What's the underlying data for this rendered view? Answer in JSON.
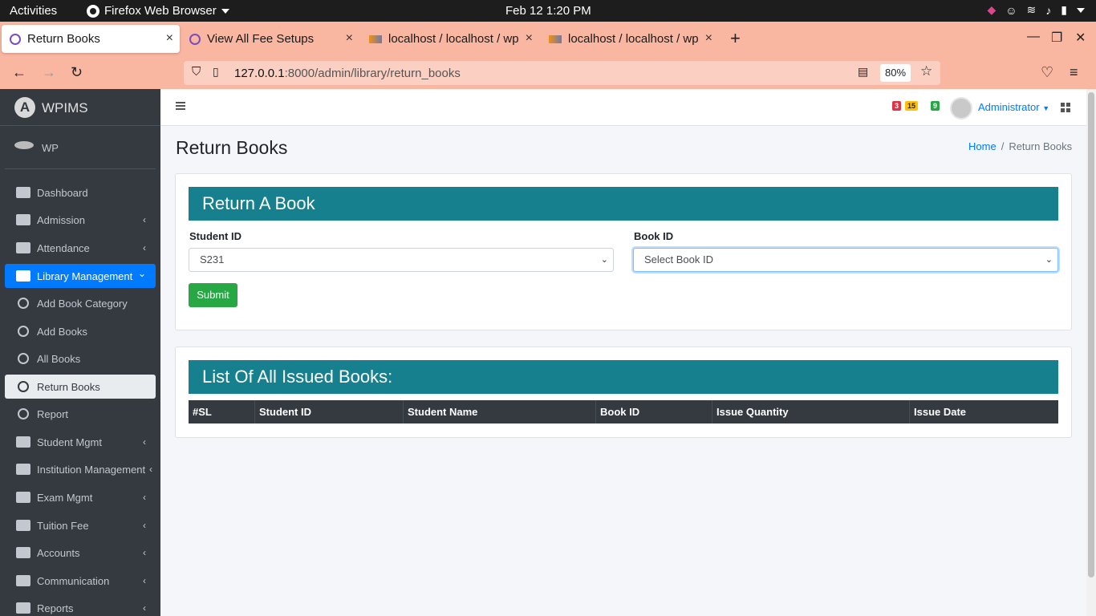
{
  "os": {
    "activities": "Activities",
    "app_name": "Firefox Web Browser",
    "clock": "Feb 12  1:20 PM"
  },
  "browser": {
    "tabs": [
      {
        "title": "Return Books",
        "active": true
      },
      {
        "title": "View All Fee Setups",
        "active": false
      },
      {
        "title": "localhost / localhost / wp",
        "active": false
      },
      {
        "title": "localhost / localhost / wp",
        "active": false
      }
    ],
    "url_host": "127.0.0.1",
    "url_rest": ":8000/admin/library/return_books",
    "zoom": "80%"
  },
  "sidebar": {
    "brand": "WPIMS",
    "brand_logo": "A",
    "user": "WP",
    "items": [
      {
        "label": "Dashboard",
        "icon": "dashboard-icon"
      },
      {
        "label": "Admission",
        "icon": "user-plus-icon",
        "arrow": "‹"
      },
      {
        "label": "Attendance",
        "icon": "tree-icon",
        "arrow": "‹"
      },
      {
        "label": "Library Management",
        "icon": "book-icon",
        "arrow": "⌄"
      },
      {
        "label": "Add Book Category",
        "icon": "circle-icon"
      },
      {
        "label": "Add Books",
        "icon": "circle-icon"
      },
      {
        "label": "All Books",
        "icon": "circle-icon"
      },
      {
        "label": "Return Books",
        "icon": "circle-icon"
      },
      {
        "label": "Report",
        "icon": "circle-icon"
      },
      {
        "label": "Student Mgmt",
        "icon": "graduate-icon",
        "arrow": "‹"
      },
      {
        "label": "Institution Management",
        "icon": "table-icon",
        "arrow": "‹"
      },
      {
        "label": "Exam Mgmt",
        "icon": "exam-icon",
        "arrow": "‹"
      },
      {
        "label": "Tuition Fee",
        "icon": "money-icon",
        "arrow": "‹"
      },
      {
        "label": "Accounts",
        "icon": "wallet-icon",
        "arrow": "‹"
      },
      {
        "label": "Communication",
        "icon": "chat-icon",
        "arrow": "‹"
      },
      {
        "label": "Reports",
        "icon": "report-icon",
        "arrow": "‹"
      }
    ]
  },
  "header": {
    "badges": [
      "3",
      "15",
      "9"
    ],
    "user": "Administrator"
  },
  "page": {
    "title": "Return Books",
    "breadcrumb": {
      "home": "Home",
      "sep": "/",
      "current": "Return Books"
    }
  },
  "return_form": {
    "heading": "Return A Book",
    "student_label": "Student ID",
    "student_value": "S231",
    "book_label": "Book ID",
    "book_value": "Select Book ID",
    "submit": "Submit"
  },
  "issued_list": {
    "heading": "List Of All Issued Books:",
    "columns": [
      "#SL",
      "Student ID",
      "Student Name",
      "Book ID",
      "Issue Quantity",
      "Issue Date"
    ],
    "rows": []
  },
  "colors": {
    "sidebar_bg": "#343a40",
    "accent_blue": "#007bff",
    "card_head": "#17808e",
    "submit_green": "#28a745",
    "browser_chrome": "#f9b6a0"
  }
}
